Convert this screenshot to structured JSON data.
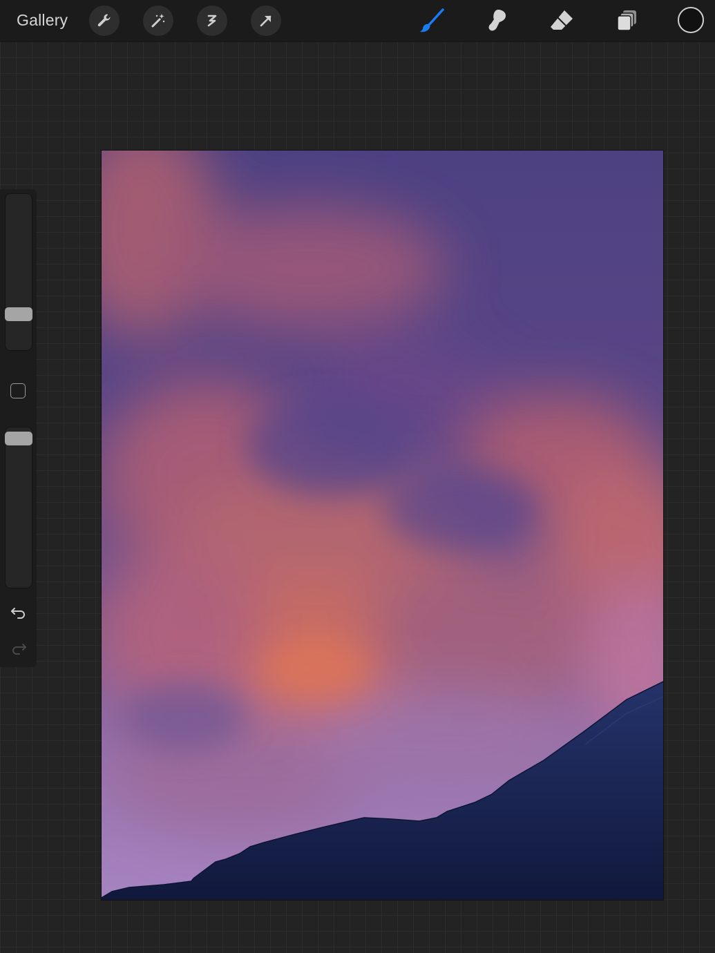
{
  "app": {
    "gallery_label": "Gallery"
  },
  "toolbar": {
    "left_tools": [
      "wrench-icon",
      "magic-wand-icon",
      "selection-icon",
      "transform-arrow-icon"
    ],
    "right_tools": [
      "brush-icon",
      "smudge-icon",
      "eraser-icon",
      "layers-icon"
    ],
    "active_tool": "brush-icon",
    "accent_color": "#1a7cf5",
    "current_color": "#111111"
  },
  "sidebar": {
    "brush_size_level": 0.18,
    "opacity_level": 0.95,
    "icons": [
      "modify-square-icon",
      "undo-icon",
      "redo-icon"
    ]
  },
  "canvas": {
    "artwork": "sunset-sky-with-mountain",
    "colors": {
      "sky_top": "#4c3f7f",
      "cloud_pink": "#c0646f",
      "cloud_orange": "#d86c5a",
      "haze_lavender": "#a07ab4",
      "mountain": "#1a2350"
    }
  }
}
